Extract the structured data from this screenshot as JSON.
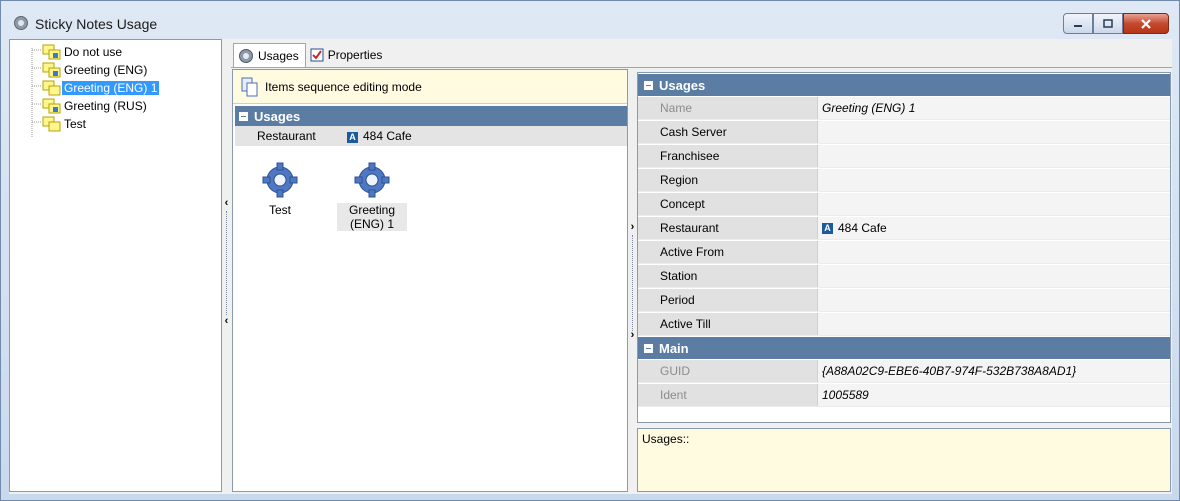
{
  "window": {
    "title": "Sticky Notes Usage",
    "buttons": {
      "minimize": "minimize",
      "maximize": "maximize",
      "close": "close"
    }
  },
  "tree": {
    "items": [
      {
        "label": "Do not use",
        "selected": false
      },
      {
        "label": "Greeting (ENG)",
        "selected": false
      },
      {
        "label": "Greeting (ENG) 1",
        "selected": true
      },
      {
        "label": "Greeting (RUS)",
        "selected": false
      },
      {
        "label": "Test",
        "selected": false
      }
    ]
  },
  "tabs": [
    {
      "label": "Usages",
      "active": true,
      "icon": "gear-icon"
    },
    {
      "label": "Properties",
      "active": false,
      "icon": "properties-icon"
    }
  ],
  "middle": {
    "banner": "Items sequence editing mode",
    "group_title": "Usages",
    "row": {
      "key": "Restaurant",
      "badge": "A",
      "value": "484 Cafe"
    },
    "usages": [
      {
        "label": "Test",
        "selected": false
      },
      {
        "label": "Greeting (ENG) 1",
        "label_line1": "Greeting",
        "label_line2": "(ENG) 1",
        "selected": true
      }
    ]
  },
  "properties": {
    "usages_title": "Usages",
    "usages_rows": [
      {
        "key": "Name",
        "value": "Greeting (ENG) 1",
        "readonly": true
      },
      {
        "key": "Cash Server",
        "value": ""
      },
      {
        "key": "Franchisee",
        "value": ""
      },
      {
        "key": "Region",
        "value": ""
      },
      {
        "key": "Concept",
        "value": ""
      },
      {
        "key": "Restaurant",
        "value": "484 Cafe",
        "badge": "A"
      },
      {
        "key": "Active From",
        "value": ""
      },
      {
        "key": "Station",
        "value": ""
      },
      {
        "key": "Period",
        "value": ""
      },
      {
        "key": "Active Till",
        "value": ""
      }
    ],
    "main_title": "Main",
    "main_rows": [
      {
        "key": "GUID",
        "value": "{A88A02C9-EBE6-40B7-974F-532B738A8AD1}",
        "readonly": true
      },
      {
        "key": "Ident",
        "value": "1005589",
        "readonly": true
      }
    ]
  },
  "description": "Usages::",
  "colors": {
    "group_header": "#5b7da3",
    "selection": "#3399ff",
    "banner_bg": "#fffbe0",
    "badge": "#1c5aa0"
  }
}
